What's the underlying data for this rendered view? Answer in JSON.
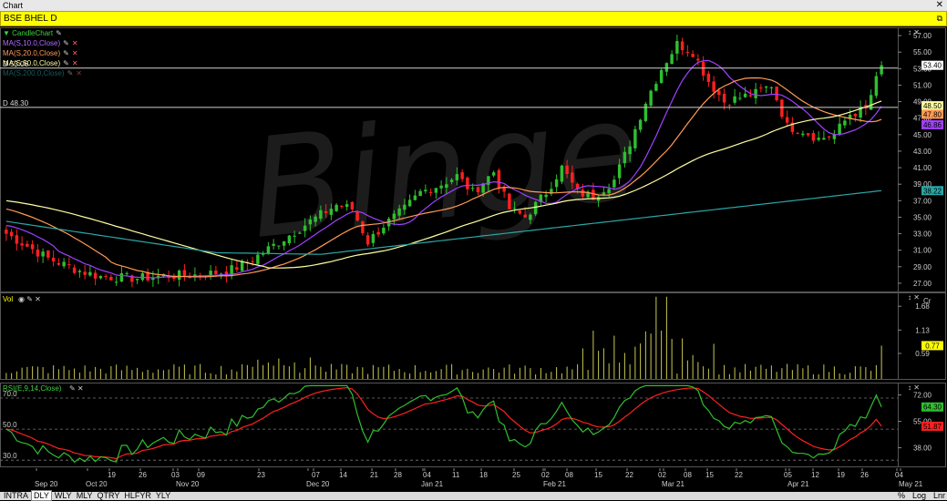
{
  "window_title": "Chart",
  "window_close": "✕",
  "symbol_title": "BSE BHEL D",
  "symbol_icon": "⧉",
  "indicators": [
    {
      "label": "CandleChart",
      "color": "#3fd13f",
      "icon": "✎"
    },
    {
      "label": "MA(S,10.0,Close)",
      "color": "#b36bff",
      "icon": "✎",
      "close": "✕"
    },
    {
      "label": "MA(S,20.0,Close)",
      "color": "#ff9a55",
      "icon": "✎",
      "close": "✕"
    },
    {
      "label": "MA(S,50.0,Close)",
      "color": "#ffffa0",
      "icon": "✎",
      "close": "✕"
    },
    {
      "label": "MA(S,200.0,Close)",
      "color": "#2aa6a6",
      "icon": "✎",
      "close": "✕"
    }
  ],
  "vol_label": "Vol",
  "rsi_label": "RSI(E,9,14,Close)",
  "hline_labels": [
    "D 53.06",
    "D 48.30"
  ],
  "right_markers": {
    "price": [
      {
        "value": "53.40",
        "bg": "#ffffff",
        "fg": "#000000"
      },
      {
        "value": "48.50",
        "bg": "#ffffa0",
        "fg": "#000000"
      },
      {
        "value": "47.80",
        "bg": "#ff9a55",
        "fg": "#000000"
      },
      {
        "value": "46.86",
        "bg": "#a040ff",
        "fg": "#000000"
      },
      {
        "value": "38.22",
        "bg": "#2aa6a6",
        "fg": "#000000"
      }
    ],
    "vol": {
      "value": "0.77",
      "bg": "#ffff00",
      "fg": "#000000"
    },
    "rsi": [
      {
        "value": "64.30",
        "bg": "#2fbf2f",
        "fg": "#000000"
      },
      {
        "value": "51.87",
        "bg": "#ff2020",
        "fg": "#000000"
      }
    ]
  },
  "vol_unit": "Cr",
  "watermark": "Binge",
  "tabs": [
    "INTRA",
    "DLY",
    "WLY",
    "MLY",
    "QTRY",
    "HLFYR",
    "YLY"
  ],
  "active_tab": "DLY",
  "right_buttons": [
    "%",
    "Log",
    "Lnr"
  ],
  "colors": {
    "up": "#2fbf2f",
    "down": "#ff2020",
    "ma10": "#a040ff",
    "ma20": "#ff9a55",
    "ma50": "#ffffa0",
    "ma200": "#2aa6a6",
    "vol": "#c8c850",
    "rsi": "#2fbf2f",
    "rsi_signal": "#ff2020",
    "grid": "#444444"
  },
  "chart_data": [
    {
      "type": "candlestick",
      "title": "BSE BHEL D",
      "ylim": [
        26.0,
        58.0
      ],
      "y_ticks": [
        "27.00",
        "29.00",
        "31.00",
        "33.00",
        "35.00",
        "37.00",
        "39.00",
        "41.00",
        "43.00",
        "45.00",
        "47.00",
        "49.00",
        "51.00",
        "53.00",
        "55.00",
        "57.00"
      ],
      "x_ticks": [
        "Sep 20",
        "Oct 20",
        "19",
        "26",
        "Nov 20",
        "03",
        "09",
        "23",
        "Dec 20",
        "07",
        "14",
        "21",
        "28",
        "04",
        "Jan 21",
        "11",
        "18",
        "25",
        "02",
        "Feb 21",
        "08",
        "15",
        "22",
        "02",
        "Mar 21",
        "08",
        "15",
        "22",
        "05",
        "Apr 21",
        "12",
        "19",
        "26",
        "04",
        "May 21"
      ],
      "horizontal_lines": [
        53.06,
        48.3
      ],
      "series": [
        {
          "name": "MA(S,10.0,Close)",
          "last": 46.86
        },
        {
          "name": "MA(S,20.0,Close)",
          "last": 47.8
        },
        {
          "name": "MA(S,50.0,Close)",
          "last": 48.5
        },
        {
          "name": "MA(S,200.0,Close)",
          "last": 38.22
        }
      ],
      "last_close": 53.4
    },
    {
      "type": "bar",
      "title": "Vol",
      "ylim": [
        0,
        2.0
      ],
      "y_ticks": [
        "0.59",
        "1.13",
        "1.68"
      ],
      "unit": "Cr",
      "last": 0.77
    },
    {
      "type": "line",
      "title": "RSI(E,9,14,Close)",
      "ylim": [
        26,
        80
      ],
      "levels": [
        30.0,
        50.0,
        70.0
      ],
      "y_ticks": [
        "38.00",
        "55.00",
        "72.00"
      ],
      "series": [
        {
          "name": "RSI",
          "last": 64.3
        },
        {
          "name": "Signal",
          "last": 51.87
        }
      ]
    }
  ]
}
